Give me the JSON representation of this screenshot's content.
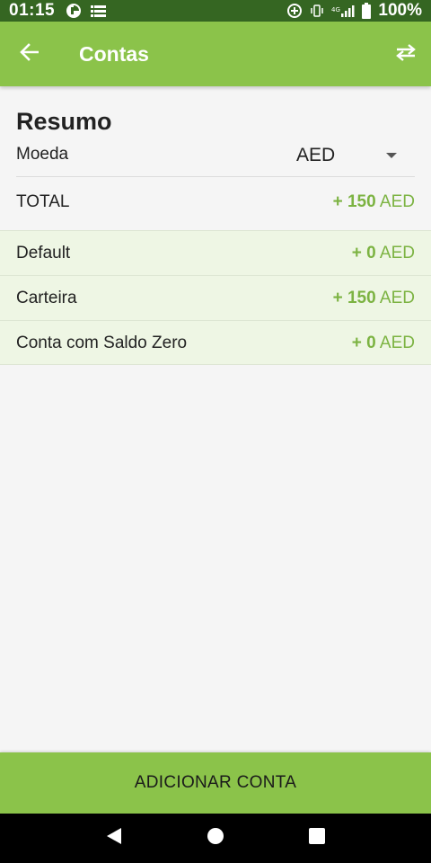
{
  "status_bar": {
    "time": "01:15",
    "battery": "100%",
    "icons": [
      "pie-icon",
      "list-icon",
      "sync-icon",
      "vibrate-icon",
      "signal-4g-icon",
      "battery-icon"
    ]
  },
  "app_bar": {
    "title": "Contas",
    "back_icon": "arrow-left-icon",
    "swap_icon": "swap-horizontal-icon",
    "color": "#8bc34a"
  },
  "summary": {
    "title": "Resumo",
    "currency_label": "Moeda",
    "currency_value": "AED",
    "total_label": "TOTAL",
    "total_sign": "+ ",
    "total_amount": "150",
    "total_currency": " AED"
  },
  "accounts": [
    {
      "name": "Default",
      "sign": "+ ",
      "amount": "0",
      "currency": " AED"
    },
    {
      "name": "Carteira",
      "sign": "+ ",
      "amount": "150",
      "currency": " AED"
    },
    {
      "name": "Conta com Saldo Zero",
      "sign": "+ ",
      "amount": "0",
      "currency": " AED"
    }
  ],
  "bottom": {
    "add_account_label": "ADICIONAR CONTA"
  },
  "colors": {
    "primary": "#8bc34a",
    "status_bar": "#356622",
    "amount_positive": "#7cb342",
    "row_background": "#eef6e4"
  }
}
